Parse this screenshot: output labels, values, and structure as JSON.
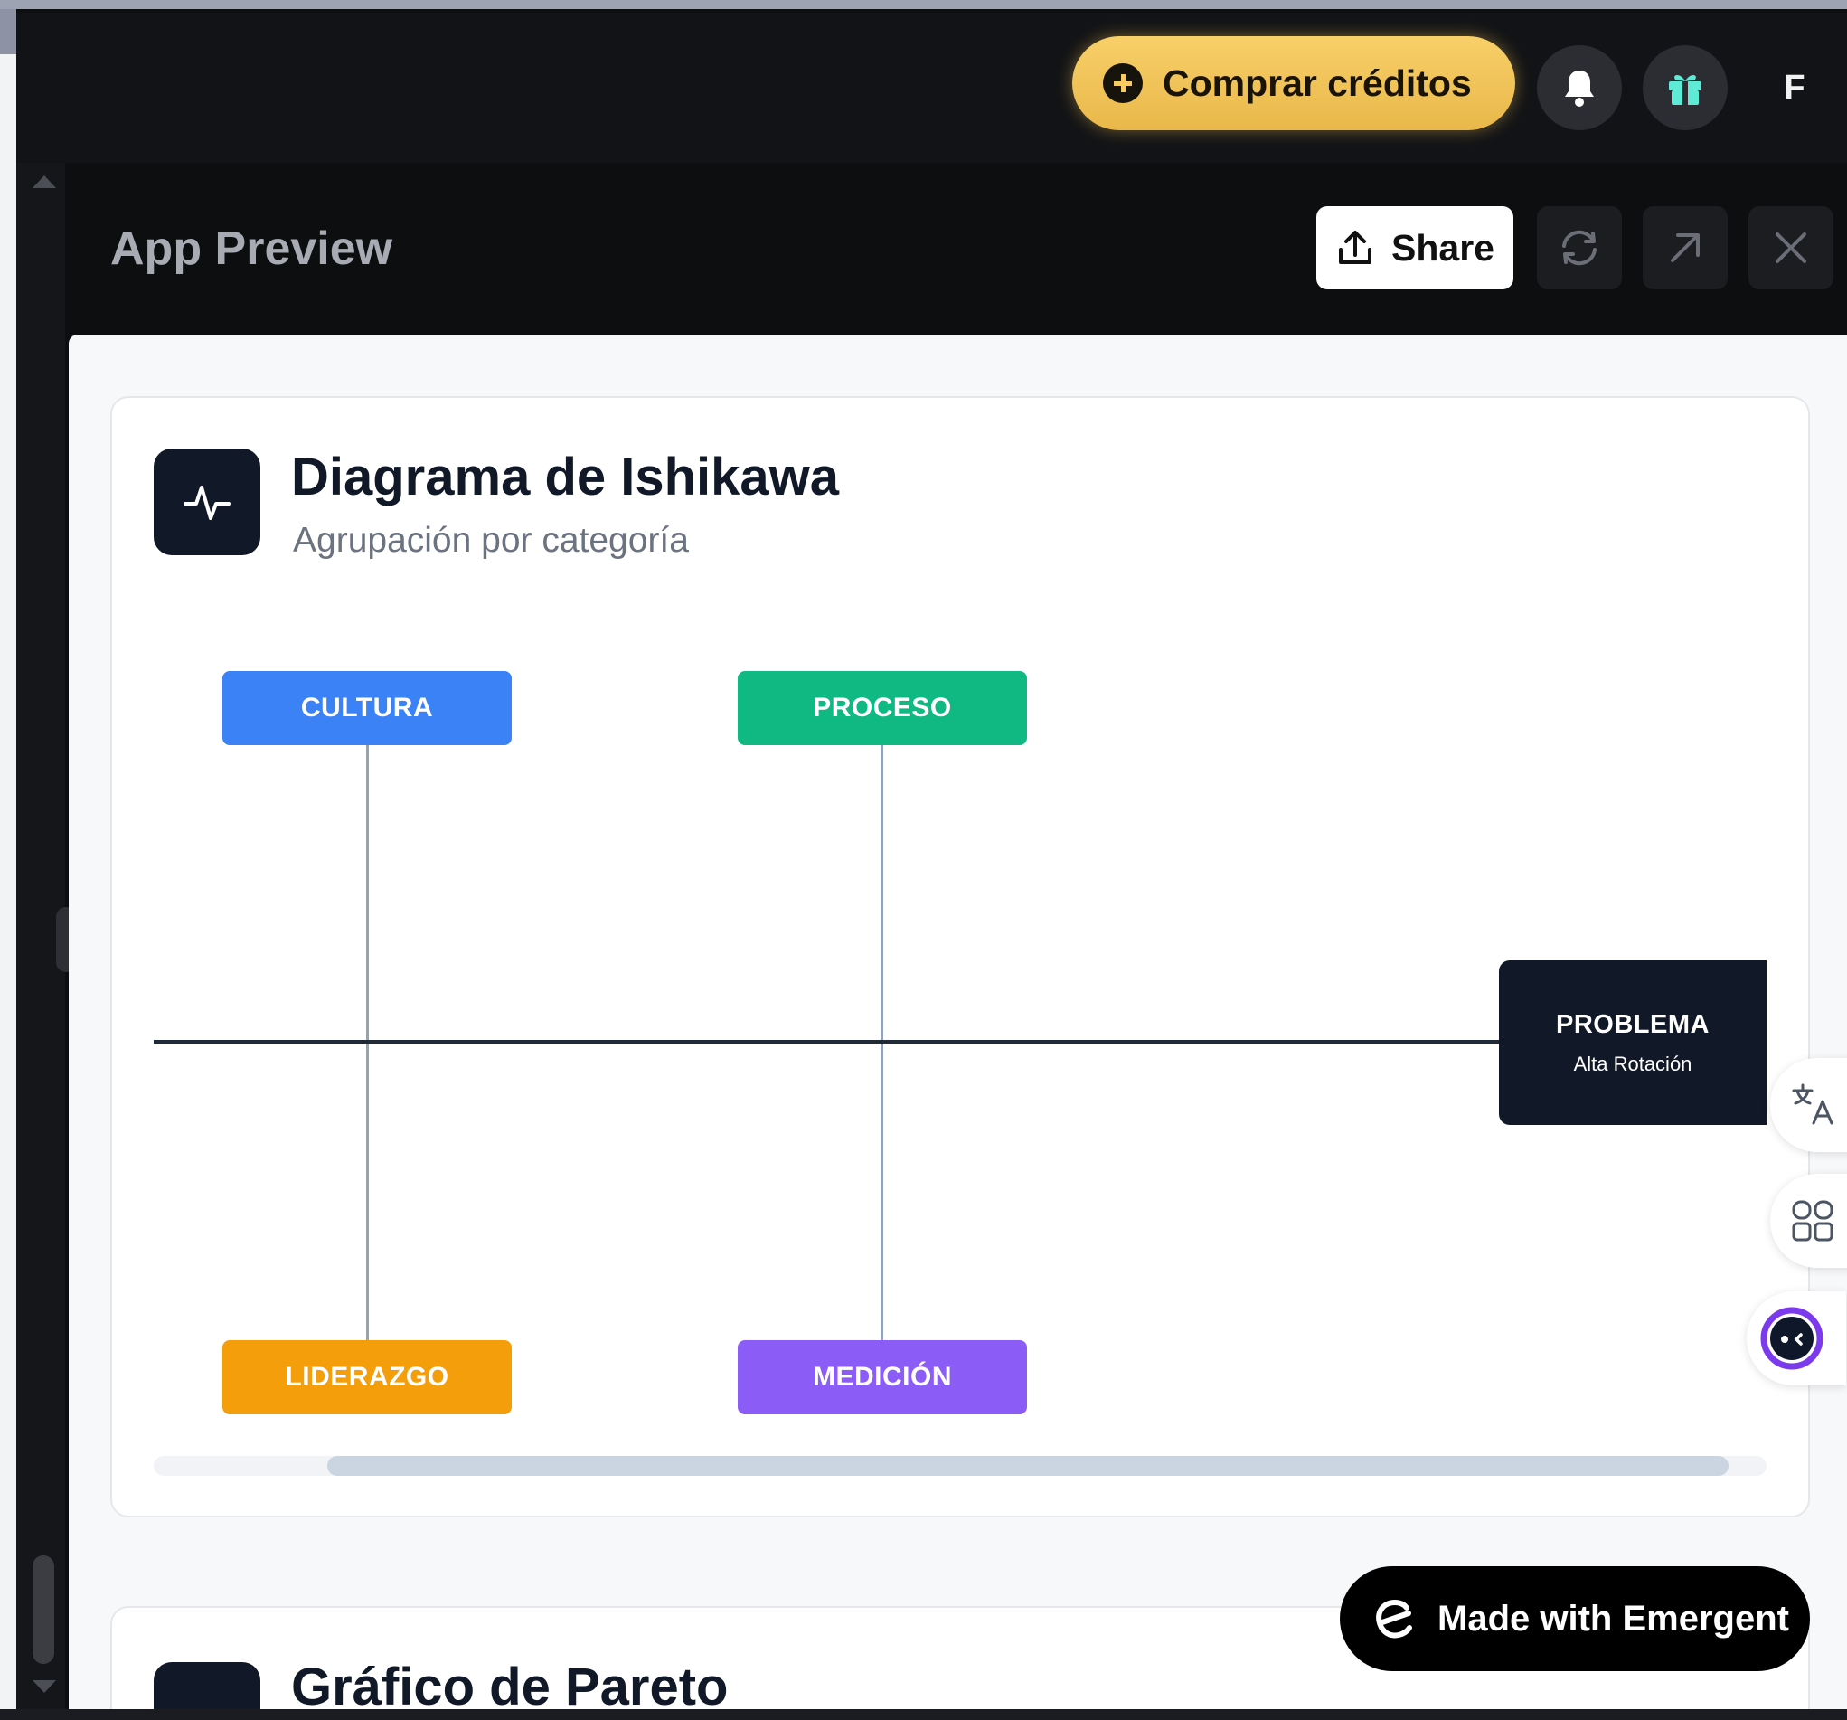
{
  "topbar": {
    "buy_credits_label": "Comprar créditos",
    "avatar_initial": "F"
  },
  "preview": {
    "title": "App Preview",
    "share_label": "Share"
  },
  "ishikawa_card": {
    "title": "Diagrama de Ishikawa",
    "subtitle": "Agrupación por categoría",
    "categories": [
      {
        "label": "CULTURA",
        "color": "#3b82f6"
      },
      {
        "label": "PROCESO",
        "color": "#10b981"
      },
      {
        "label": "LIDERAZGO",
        "color": "#f59e0b"
      },
      {
        "label": "MEDICIÓN",
        "color": "#8b5cf6"
      }
    ],
    "problem_label": "PROBLEMA",
    "problem_value": "Alta Rotación"
  },
  "pareto_card": {
    "title": "Gráfico de Pareto"
  },
  "badge": {
    "label": "Made with Emergent"
  },
  "colors": {
    "accent_gold": "#f3c55a",
    "dark": "#111827"
  }
}
